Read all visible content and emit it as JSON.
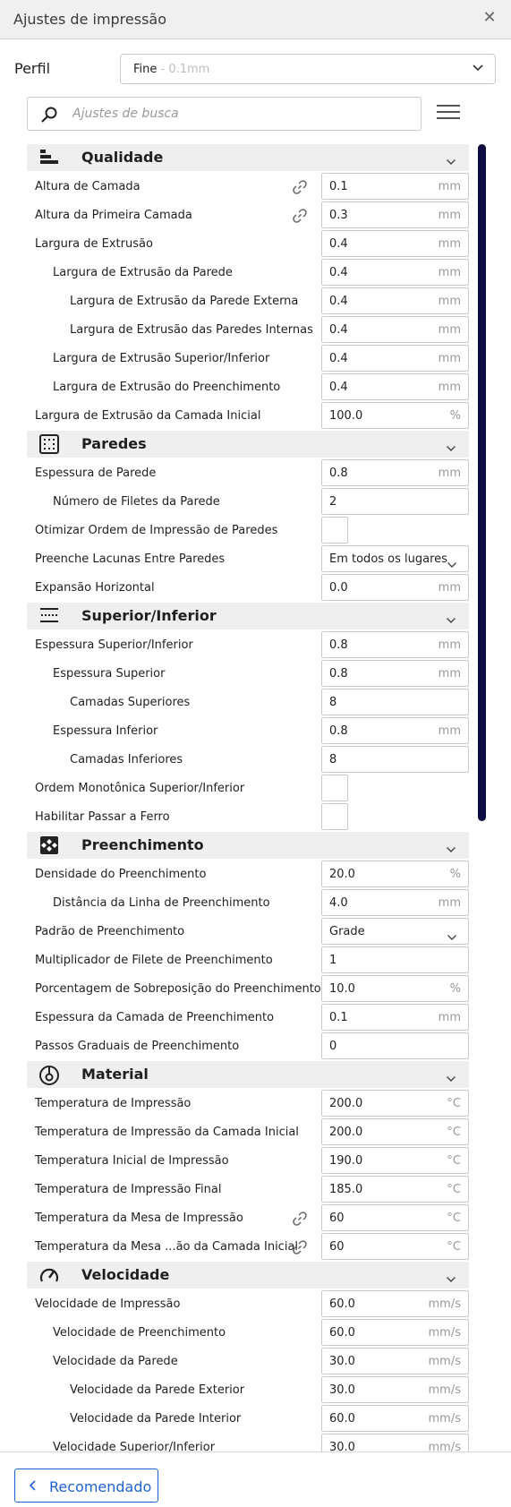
{
  "window": {
    "title": "Ajustes de impressão"
  },
  "profile": {
    "label": "Perfil",
    "value": "Fine",
    "value_sub": " - 0.1mm"
  },
  "search": {
    "placeholder": "Ajustes de busca"
  },
  "footer": {
    "recommended_label": "Recomendado"
  },
  "sections": [
    {
      "name": "Qualidade",
      "icon": "quality-icon",
      "rows": [
        {
          "label": "Altura de Camada",
          "indent": 0,
          "type": "num",
          "value": "0.1",
          "unit": "mm",
          "linked": true
        },
        {
          "label": "Altura da Primeira Camada",
          "indent": 0,
          "type": "num",
          "value": "0.3",
          "unit": "mm",
          "linked": true
        },
        {
          "label": "Largura de Extrusão",
          "indent": 0,
          "type": "num",
          "value": "0.4",
          "unit": "mm"
        },
        {
          "label": "Largura de Extrusão da Parede",
          "indent": 1,
          "type": "num",
          "value": "0.4",
          "unit": "mm"
        },
        {
          "label": "Largura de Extrusão da Parede Externa",
          "indent": 2,
          "type": "num",
          "value": "0.4",
          "unit": "mm"
        },
        {
          "label": "Largura de Extrusão das Paredes Internas",
          "indent": 2,
          "type": "num",
          "value": "0.4",
          "unit": "mm"
        },
        {
          "label": "Largura de Extrusão Superior/Inferior",
          "indent": 1,
          "type": "num",
          "value": "0.4",
          "unit": "mm"
        },
        {
          "label": "Largura de Extrusão do Preenchimento",
          "indent": 1,
          "type": "num",
          "value": "0.4",
          "unit": "mm"
        },
        {
          "label": "Largura de Extrusão da Camada Inicial",
          "indent": 0,
          "type": "num",
          "value": "100.0",
          "unit": "%"
        }
      ]
    },
    {
      "name": "Paredes",
      "icon": "walls-icon",
      "rows": [
        {
          "label": "Espessura de Parede",
          "indent": 0,
          "type": "num",
          "value": "0.8",
          "unit": "mm"
        },
        {
          "label": "Número de Filetes da Parede",
          "indent": 1,
          "type": "num",
          "value": "2",
          "unit": ""
        },
        {
          "label": "Otimizar Ordem de Impressão de Paredes",
          "indent": 0,
          "type": "check"
        },
        {
          "label": "Preenche Lacunas Entre Paredes",
          "indent": 0,
          "type": "select",
          "value": "Em todos os lugares"
        },
        {
          "label": "Expansão Horizontal",
          "indent": 0,
          "type": "num",
          "value": "0.0",
          "unit": "mm"
        }
      ]
    },
    {
      "name": "Superior/Inferior",
      "icon": "top-bottom-icon",
      "rows": [
        {
          "label": "Espessura Superior/Inferior",
          "indent": 0,
          "type": "num",
          "value": "0.8",
          "unit": "mm"
        },
        {
          "label": "Espessura Superior",
          "indent": 1,
          "type": "num",
          "value": "0.8",
          "unit": "mm"
        },
        {
          "label": "Camadas Superiores",
          "indent": 2,
          "type": "num",
          "value": "8",
          "unit": ""
        },
        {
          "label": "Espessura Inferior",
          "indent": 1,
          "type": "num",
          "value": "0.8",
          "unit": "mm"
        },
        {
          "label": "Camadas Inferiores",
          "indent": 2,
          "type": "num",
          "value": "8",
          "unit": ""
        },
        {
          "label": "Ordem Monotônica Superior/Inferior",
          "indent": 0,
          "type": "check"
        },
        {
          "label": "Habilitar Passar a Ferro",
          "indent": 0,
          "type": "check"
        }
      ]
    },
    {
      "name": "Preenchimento",
      "icon": "infill-icon",
      "rows": [
        {
          "label": "Densidade do Preenchimento",
          "indent": 0,
          "type": "num",
          "value": "20.0",
          "unit": "%"
        },
        {
          "label": "Distância da Linha de Preenchimento",
          "indent": 1,
          "type": "num",
          "value": "4.0",
          "unit": "mm"
        },
        {
          "label": "Padrão de Preenchimento",
          "indent": 0,
          "type": "select",
          "value": "Grade"
        },
        {
          "label": "Multiplicador de Filete de Preenchimento",
          "indent": 0,
          "type": "num",
          "value": "1",
          "unit": ""
        },
        {
          "label": "Porcentagem de Sobreposição do Preenchimento",
          "indent": 0,
          "type": "num",
          "value": "10.0",
          "unit": "%"
        },
        {
          "label": "Espessura da Camada de Preenchimento",
          "indent": 0,
          "type": "num",
          "value": "0.1",
          "unit": "mm"
        },
        {
          "label": "Passos Graduais de Preenchimento",
          "indent": 0,
          "type": "num",
          "value": "0",
          "unit": ""
        }
      ]
    },
    {
      "name": "Material",
      "icon": "material-spool-icon",
      "rows": [
        {
          "label": "Temperatura de Impressão",
          "indent": 0,
          "type": "num",
          "value": "200.0",
          "unit": "°C"
        },
        {
          "label": "Temperatura de Impressão da Camada Inicial",
          "indent": 0,
          "type": "num",
          "value": "200.0",
          "unit": "°C"
        },
        {
          "label": "Temperatura Inicial de Impressão",
          "indent": 0,
          "type": "num",
          "value": "190.0",
          "unit": "°C"
        },
        {
          "label": "Temperatura de Impressão Final",
          "indent": 0,
          "type": "num",
          "value": "185.0",
          "unit": "°C"
        },
        {
          "label": "Temperatura da Mesa de Impressão",
          "indent": 0,
          "type": "num",
          "value": "60",
          "unit": "°C",
          "linked": true
        },
        {
          "label": "Temperatura da Mesa ...ão da Camada Inicial",
          "indent": 0,
          "type": "num",
          "value": "60",
          "unit": "°C",
          "linked": true
        }
      ]
    },
    {
      "name": "Velocidade",
      "icon": "speed-gauge-icon",
      "rows": [
        {
          "label": "Velocidade de Impressão",
          "indent": 0,
          "type": "num",
          "value": "60.0",
          "unit": "mm/s"
        },
        {
          "label": "Velocidade de Preenchimento",
          "indent": 1,
          "type": "num",
          "value": "60.0",
          "unit": "mm/s"
        },
        {
          "label": "Velocidade da Parede",
          "indent": 1,
          "type": "num",
          "value": "30.0",
          "unit": "mm/s"
        },
        {
          "label": "Velocidade da Parede Exterior",
          "indent": 2,
          "type": "num",
          "value": "30.0",
          "unit": "mm/s"
        },
        {
          "label": "Velocidade da Parede Interior",
          "indent": 2,
          "type": "num",
          "value": "60.0",
          "unit": "mm/s"
        },
        {
          "label": "Velocidade Superior/Inferior",
          "indent": 1,
          "type": "num",
          "value": "30.0",
          "unit": "mm/s"
        }
      ]
    }
  ]
}
